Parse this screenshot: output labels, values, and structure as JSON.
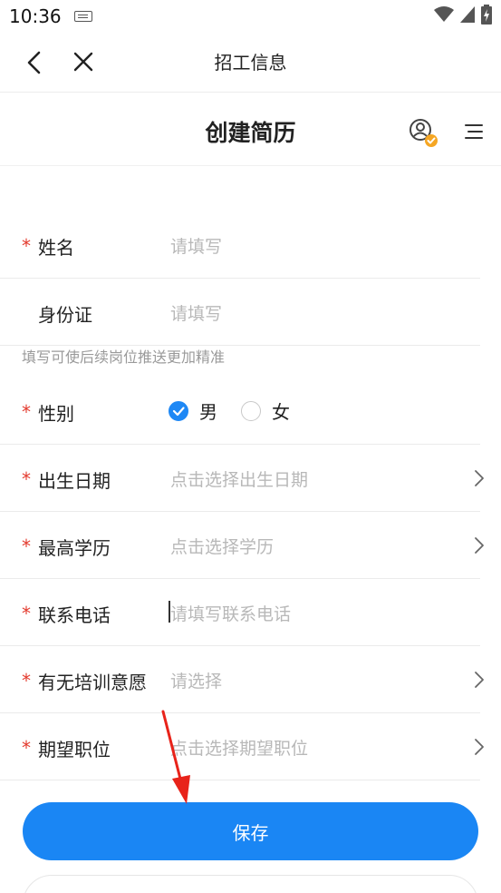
{
  "status": {
    "time": "10:36"
  },
  "nav": {
    "title": "招工信息"
  },
  "header": {
    "title": "创建简历"
  },
  "form": {
    "required_mark": "*",
    "name": {
      "label": "姓名",
      "placeholder": "请填写"
    },
    "id_card": {
      "label": "身份证",
      "placeholder": "请填写"
    },
    "hint": "填写可使后续岗位推送更加精准",
    "gender": {
      "label": "性别",
      "options": [
        "男",
        "女"
      ],
      "selected": "男"
    },
    "birth": {
      "label": "出生日期",
      "placeholder": "点击选择出生日期"
    },
    "education": {
      "label": "最高学历",
      "placeholder": "点击选择学历"
    },
    "phone": {
      "label": "联系电话",
      "placeholder": "请填写联系电话"
    },
    "training": {
      "label": "有无培训意愿",
      "placeholder": "请选择"
    },
    "position": {
      "label": "期望职位",
      "placeholder": "点击选择期望职位"
    }
  },
  "actions": {
    "save_label": "保存"
  },
  "colors": {
    "accent": "#1a86f4",
    "required": "#e33a2d",
    "annotation_arrow": "#e8231a"
  }
}
